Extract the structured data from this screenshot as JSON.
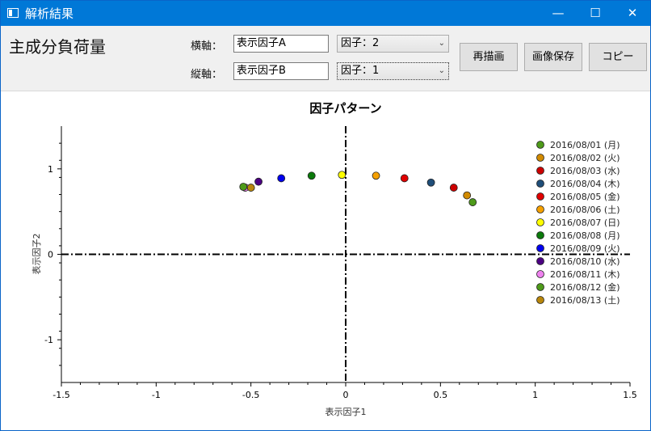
{
  "window": {
    "title": "解析結果",
    "controls": {
      "minimize": "—",
      "maximize": "☐",
      "close": "✕"
    }
  },
  "toolbar": {
    "heading": "主成分負荷量",
    "x_axis_label": "横軸：",
    "y_axis_label": "縦軸：",
    "x_name_value": "表示因子A",
    "y_name_value": "表示因子B",
    "x_factor_selected": "因子：2",
    "y_factor_selected": "因子：1",
    "redraw_label": "再描画",
    "save_image_label": "画像保存",
    "copy_label": "コピー"
  },
  "chart_data": {
    "type": "scatter",
    "title": "因子パターン",
    "xlabel": "表示因子1",
    "ylabel": "表示因子2",
    "xlim": [
      -1.5,
      1.5
    ],
    "ylim": [
      -1.5,
      1.5
    ],
    "xticks": [
      -1.5,
      -1,
      -0.5,
      0,
      0.5,
      1,
      1.5
    ],
    "xtick_labels": [
      "-1.5",
      "-1",
      "-0.5",
      "0",
      "0.5",
      "1",
      "1.5"
    ],
    "yticks": [
      -1,
      0,
      1
    ],
    "ytick_labels": [
      "-1",
      "0",
      "1"
    ],
    "legend_position": "top-right",
    "grid": false,
    "reference_lines": [
      0,
      0
    ],
    "series": [
      {
        "name": "2016/08/01 (月)",
        "color": "#4e9a1a",
        "x": 0.67,
        "y": 0.61
      },
      {
        "name": "2016/08/02 (火)",
        "color": "#d18a00",
        "x": 0.64,
        "y": 0.69
      },
      {
        "name": "2016/08/03 (水)",
        "color": "#cc0000",
        "x": 0.57,
        "y": 0.78
      },
      {
        "name": "2016/08/04 (木)",
        "color": "#1f4e79",
        "x": 0.45,
        "y": 0.84
      },
      {
        "name": "2016/08/05 (金)",
        "color": "#e00000",
        "x": 0.31,
        "y": 0.89
      },
      {
        "name": "2016/08/06 (土)",
        "color": "#f5a000",
        "x": 0.16,
        "y": 0.92
      },
      {
        "name": "2016/08/07 (日)",
        "color": "#ffff00",
        "x": -0.02,
        "y": 0.93
      },
      {
        "name": "2016/08/08 (月)",
        "color": "#0b7a0b",
        "x": -0.18,
        "y": 0.92
      },
      {
        "name": "2016/08/09 (火)",
        "color": "#0000ee",
        "x": -0.34,
        "y": 0.89
      },
      {
        "name": "2016/08/10 (水)",
        "color": "#4b0082",
        "x": -0.46,
        "y": 0.85
      },
      {
        "name": "2016/08/11 (木)",
        "color": "#ee82ee",
        "x": -0.53,
        "y": 0.78
      },
      {
        "name": "2016/08/12 (金)",
        "color": "#4e9a1a",
        "x": -0.54,
        "y": 0.79
      },
      {
        "name": "2016/08/13 (土)",
        "color": "#b8860b",
        "x": -0.5,
        "y": 0.78
      }
    ]
  }
}
